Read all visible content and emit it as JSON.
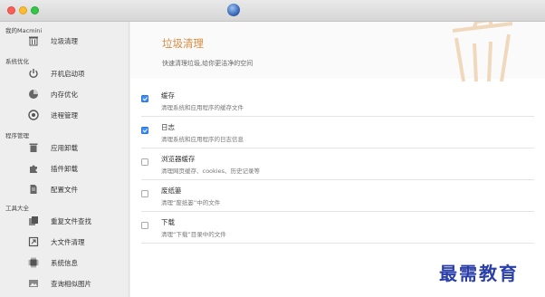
{
  "window": {
    "title": ""
  },
  "sidebar": {
    "sections": [
      {
        "label": "我的Macmini",
        "items": [
          {
            "label": "垃圾清理",
            "icon": "trash-icon"
          }
        ]
      },
      {
        "label": "系统优化",
        "items": [
          {
            "label": "开机启动项",
            "icon": "power-icon"
          },
          {
            "label": "内存优化",
            "icon": "memory-icon"
          },
          {
            "label": "进程管理",
            "icon": "process-icon"
          }
        ]
      },
      {
        "label": "程序管理",
        "items": [
          {
            "label": "应用卸载",
            "icon": "uninstall-icon"
          },
          {
            "label": "插件卸载",
            "icon": "puzzle-icon"
          },
          {
            "label": "配置文件",
            "icon": "file-icon"
          }
        ]
      },
      {
        "label": "工具大全",
        "items": [
          {
            "label": "重复文件查找",
            "icon": "duplicate-icon"
          },
          {
            "label": "大文件清理",
            "icon": "large-file-icon"
          },
          {
            "label": "系统信息",
            "icon": "chip-icon"
          },
          {
            "label": "查询相似图片",
            "icon": "image-icon"
          }
        ]
      }
    ]
  },
  "main": {
    "title": "垃圾清理",
    "subtitle": "快速清理垃圾,给你更洁净的空间",
    "options": [
      {
        "title": "缓存",
        "desc": "清理系统和应用程序的缓存文件",
        "checked": true
      },
      {
        "title": "日志",
        "desc": "清理系统和应用程序的日志信息",
        "checked": true
      },
      {
        "title": "浏览器缓存",
        "desc": "清理网页缓存、cookies、历史记录等",
        "checked": false
      },
      {
        "title": "废纸篓",
        "desc": "清理“废纸篓”中的文件",
        "checked": false
      },
      {
        "title": "下载",
        "desc": "清理“下载”目录中的文件",
        "checked": false
      }
    ]
  },
  "watermark": "最需教育",
  "colors": {
    "accent": "#d98a3d",
    "checkbox": "#3f8df6"
  }
}
